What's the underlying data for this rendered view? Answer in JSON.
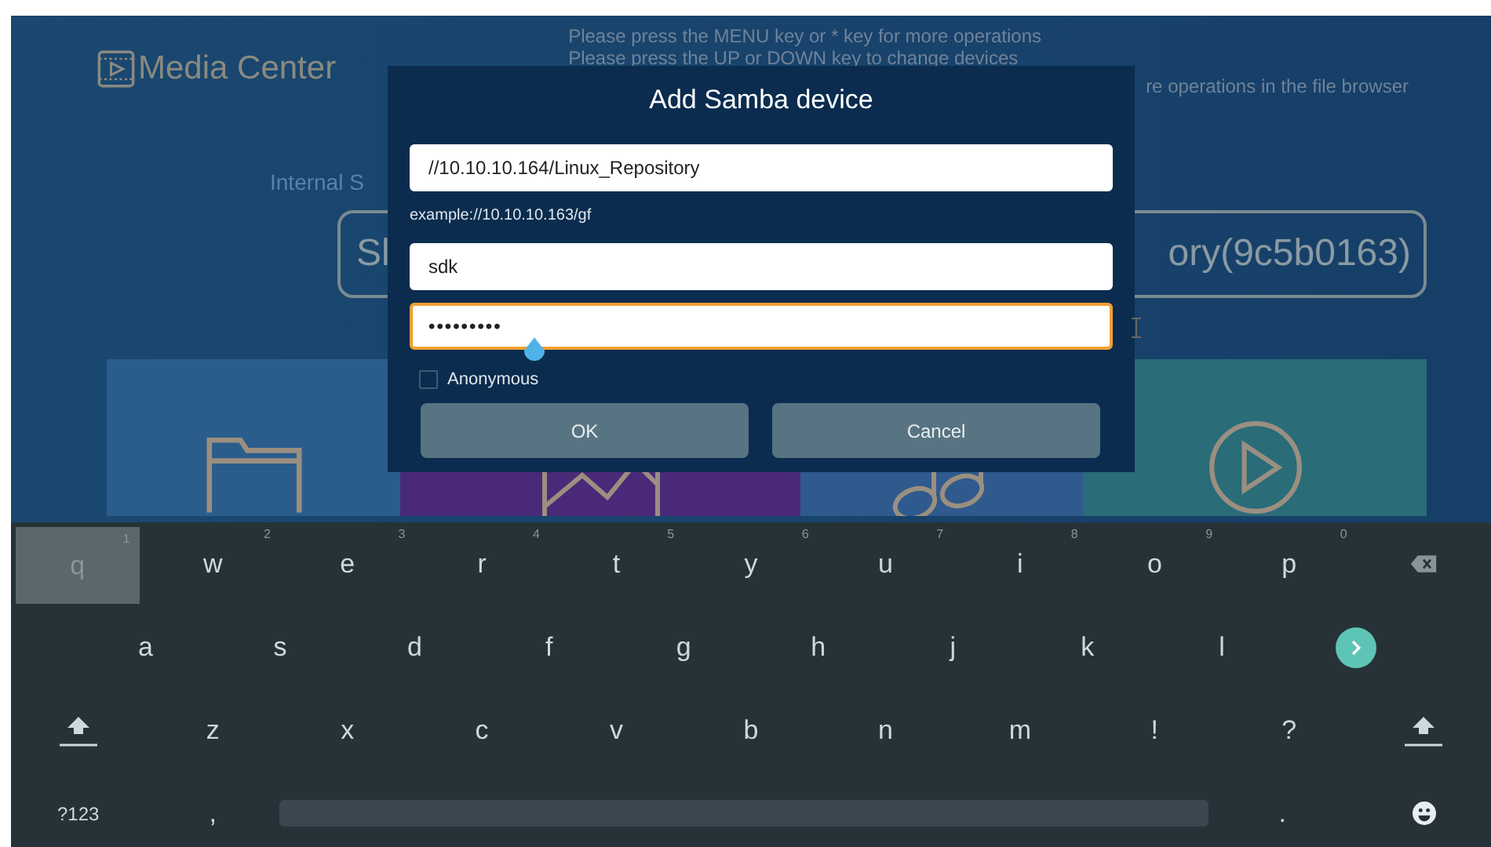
{
  "app": {
    "title": "Media Center"
  },
  "hints": [
    "Please press the MENU key or * key for more operations",
    "Please press the UP or DOWN key to change devices"
  ],
  "hint_partial": "re operations in the file browser",
  "storage_label": "Internal S",
  "device": {
    "left_text": "Sl",
    "right_text": "ory(9c5b0163)"
  },
  "tiles": [
    {
      "kind": "folder"
    },
    {
      "kind": "picture"
    },
    {
      "kind": "music"
    },
    {
      "kind": "video"
    }
  ],
  "dialog": {
    "title": "Add Samba device",
    "fields": [
      {
        "kind": "text",
        "value": "//10.10.10.164/Linux_Repository",
        "focused": false
      },
      {
        "kind": "text",
        "value": "sdk",
        "focused": false
      },
      {
        "kind": "password",
        "value": "•••••••••",
        "focused": true
      }
    ],
    "example": "example://10.10.10.163/gf",
    "anonymous": {
      "label": "Anonymous",
      "checked": false
    },
    "buttons": [
      "OK",
      "Cancel"
    ]
  },
  "keyboard": {
    "rows": [
      [
        {
          "kind": "char",
          "label": "q",
          "hint": "1",
          "selected": true
        },
        {
          "kind": "char",
          "label": "w",
          "hint": "2",
          "selected": false
        },
        {
          "kind": "char",
          "label": "e",
          "hint": "3",
          "selected": false
        },
        {
          "kind": "char",
          "label": "r",
          "hint": "4",
          "selected": false
        },
        {
          "kind": "char",
          "label": "t",
          "hint": "5",
          "selected": false
        },
        {
          "kind": "char",
          "label": "y",
          "hint": "6",
          "selected": false
        },
        {
          "kind": "char",
          "label": "u",
          "hint": "7",
          "selected": false
        },
        {
          "kind": "char",
          "label": "i",
          "hint": "8",
          "selected": false
        },
        {
          "kind": "char",
          "label": "o",
          "hint": "9",
          "selected": false
        },
        {
          "kind": "char",
          "label": "p",
          "hint": "0",
          "selected": false
        },
        {
          "kind": "backspace",
          "selected": false
        }
      ],
      [
        {
          "kind": "char",
          "label": "a",
          "selected": false
        },
        {
          "kind": "char",
          "label": "s",
          "selected": false
        },
        {
          "kind": "char",
          "label": "d",
          "selected": false
        },
        {
          "kind": "char",
          "label": "f",
          "selected": false
        },
        {
          "kind": "char",
          "label": "g",
          "selected": false
        },
        {
          "kind": "char",
          "label": "h",
          "selected": false
        },
        {
          "kind": "char",
          "label": "j",
          "selected": false
        },
        {
          "kind": "char",
          "label": "k",
          "selected": false
        },
        {
          "kind": "char",
          "label": "l",
          "selected": false
        },
        {
          "kind": "enter",
          "selected": false
        }
      ],
      [
        {
          "kind": "shift",
          "selected": false
        },
        {
          "kind": "char",
          "label": "z",
          "selected": false
        },
        {
          "kind": "char",
          "label": "x",
          "selected": false
        },
        {
          "kind": "char",
          "label": "c",
          "selected": false
        },
        {
          "kind": "char",
          "label": "v",
          "selected": false
        },
        {
          "kind": "char",
          "label": "b",
          "selected": false
        },
        {
          "kind": "char",
          "label": "n",
          "selected": false
        },
        {
          "kind": "char",
          "label": "m",
          "selected": false
        },
        {
          "kind": "char",
          "label": "!",
          "selected": false
        },
        {
          "kind": "char",
          "label": "?",
          "selected": false
        },
        {
          "kind": "shift",
          "selected": false
        }
      ],
      [
        {
          "kind": "char",
          "label": "?123",
          "selected": false
        },
        {
          "kind": "char",
          "label": ",",
          "selected": false
        },
        {
          "kind": "space",
          "selected": false
        },
        {
          "kind": "char",
          "label": ".",
          "selected": false
        },
        {
          "kind": "emoji",
          "selected": false
        }
      ]
    ]
  }
}
